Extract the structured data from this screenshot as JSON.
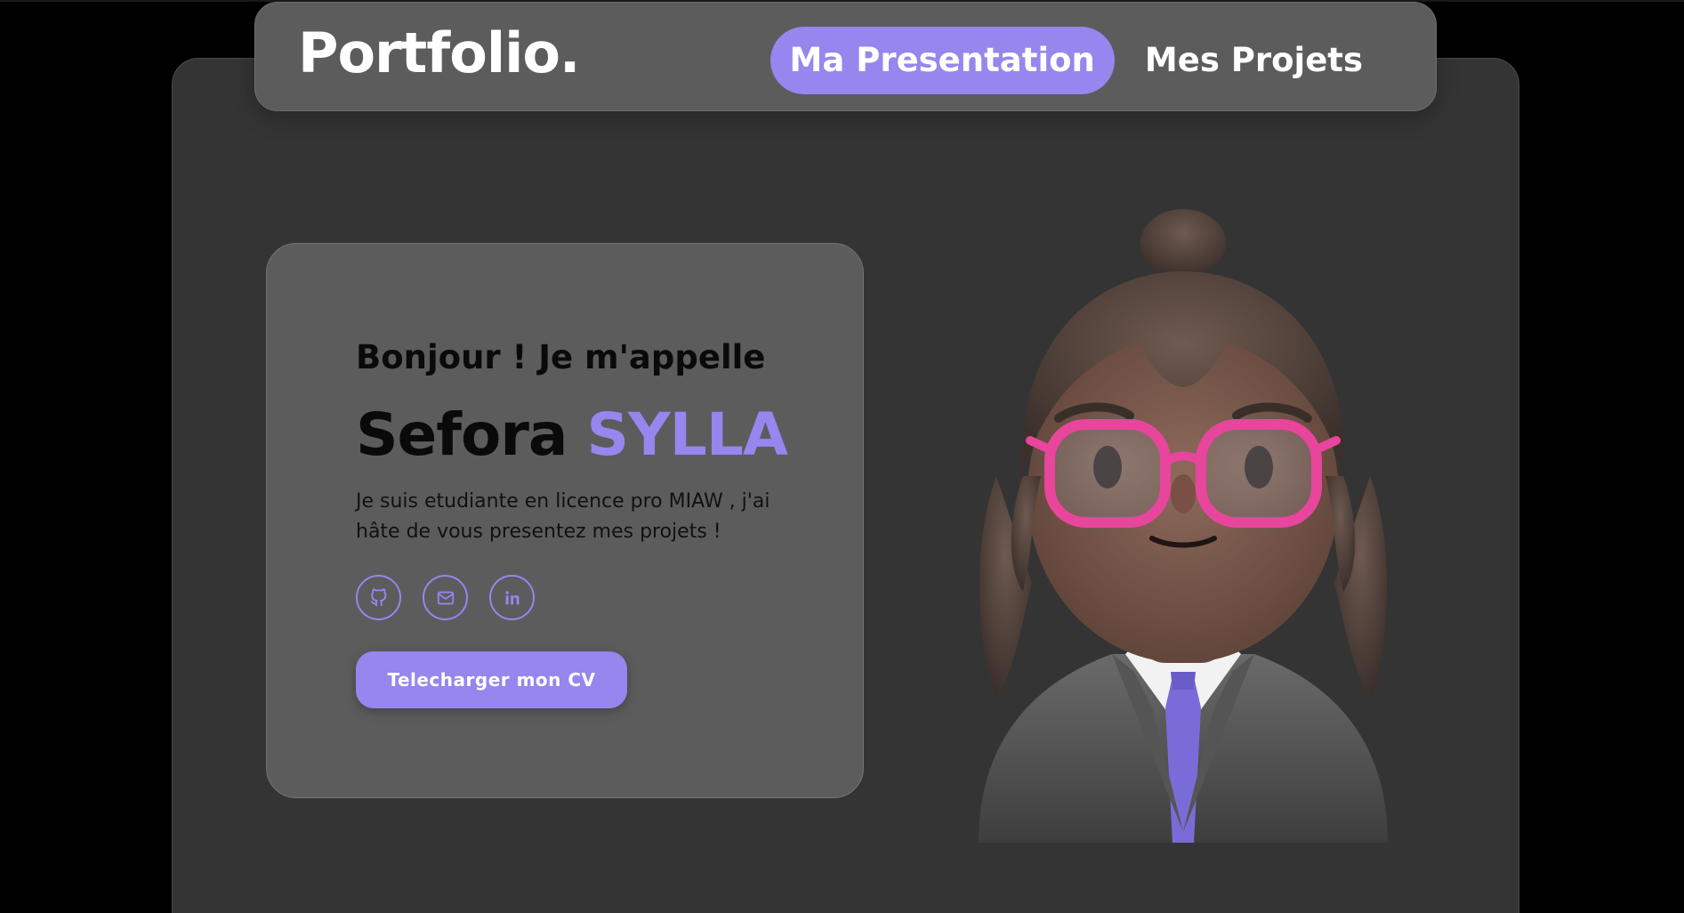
{
  "header": {
    "logo": "Portfolio.",
    "nav": [
      {
        "label": "Ma Presentation",
        "active": true
      },
      {
        "label": "Mes Projets",
        "active": false
      }
    ]
  },
  "intro": {
    "greeting": "Bonjour ! Je m'appelle",
    "first_name": "Sefora",
    "last_name": "SYLLA",
    "description": "Je suis etudiante en licence pro MIAW , j'ai hâte de vous presentez mes projets !",
    "socials": [
      {
        "icon": "github-icon"
      },
      {
        "icon": "mail-icon"
      },
      {
        "icon": "linkedin-icon"
      }
    ],
    "cv_button": "Telecharger mon CV"
  },
  "colors": {
    "accent": "#9686ee",
    "background": "#000000",
    "panel": "#343434",
    "card": "#5c5c5c",
    "glasses": "#e8459c"
  },
  "avatar": {
    "icon": "memoji-avatar"
  }
}
